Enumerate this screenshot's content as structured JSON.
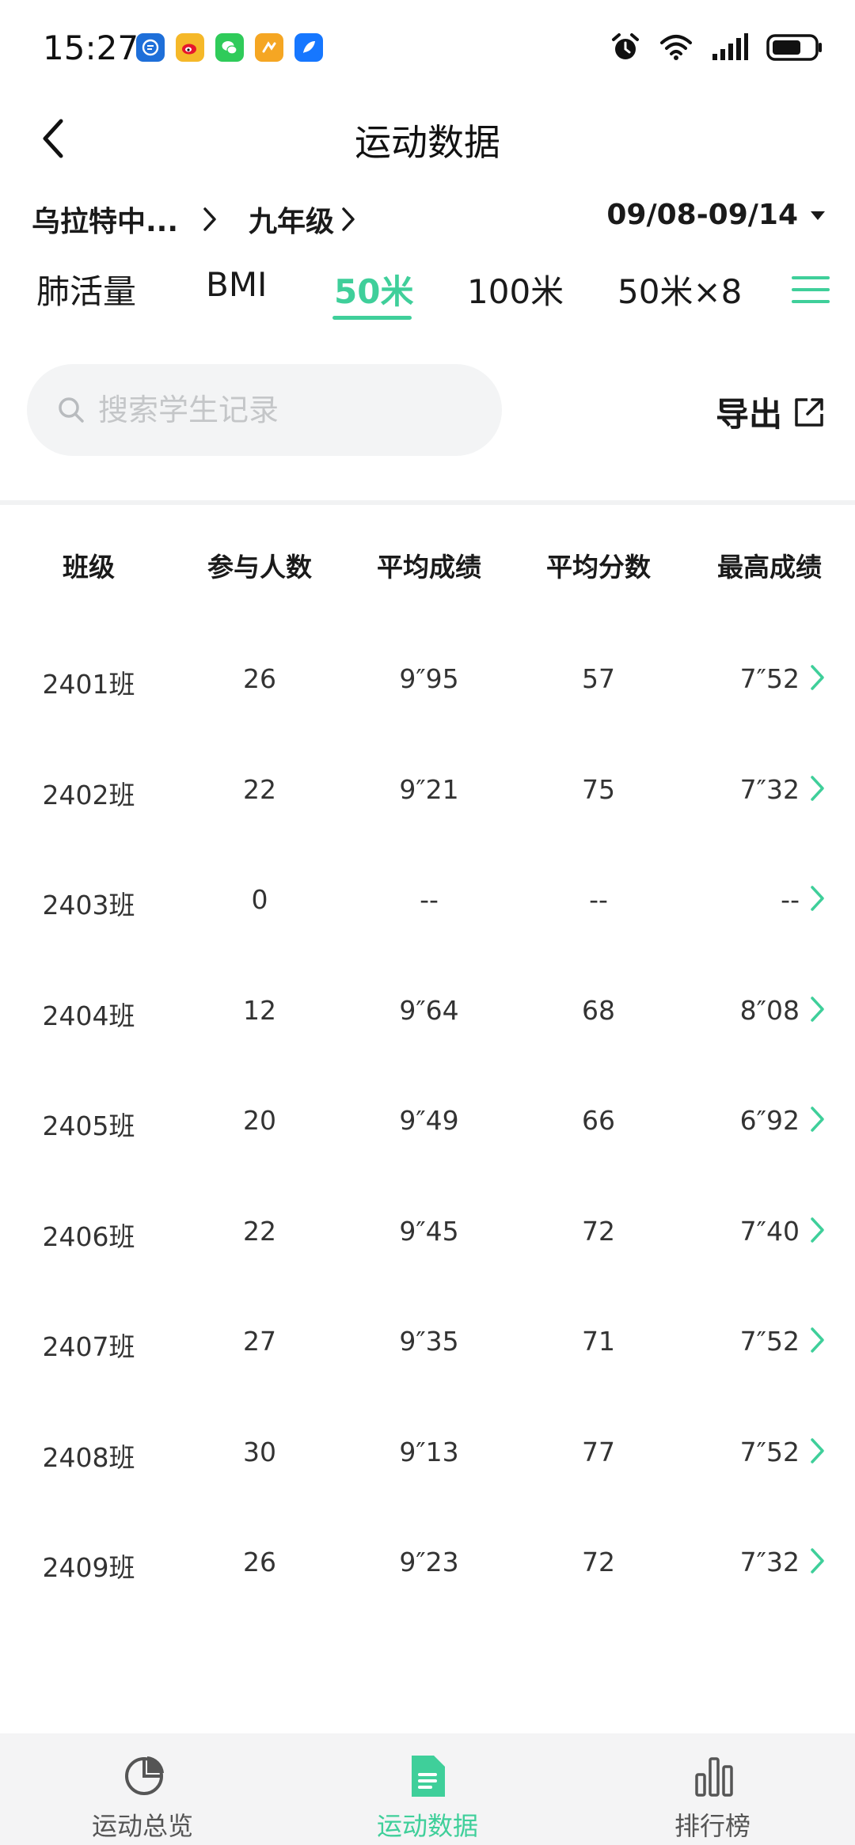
{
  "status_bar": {
    "time": "15:27",
    "app_icons": [
      {
        "name": "message-app-icon",
        "color": "#1e6fd9"
      },
      {
        "name": "weibo-icon",
        "color": "#f5b829"
      },
      {
        "name": "wechat-icon",
        "color": "#2fcb5a"
      },
      {
        "name": "sport-app-icon",
        "color": "#f5a623"
      },
      {
        "name": "feather-app-icon",
        "color": "#1677ff"
      }
    ],
    "battery_level": 0.65
  },
  "header": {
    "title": "运动数据"
  },
  "filters": {
    "school": "乌拉特中...",
    "grade": "九年级",
    "date_range": "09/08-09/14"
  },
  "tabs": [
    {
      "label": "肺活量",
      "active": false
    },
    {
      "label": "BMI",
      "active": false
    },
    {
      "label": "50米",
      "active": true
    },
    {
      "label": "100米",
      "active": false
    },
    {
      "label": "50米×8",
      "active": false
    }
  ],
  "search": {
    "placeholder": "搜索学生记录",
    "value": ""
  },
  "export": {
    "label": "导出"
  },
  "table": {
    "columns": [
      "班级",
      "参与人数",
      "平均成绩",
      "平均分数",
      "最高成绩"
    ],
    "rows": [
      [
        "2401班",
        "26",
        "9″95",
        "57",
        "7″52"
      ],
      [
        "2402班",
        "22",
        "9″21",
        "75",
        "7″32"
      ],
      [
        "2403班",
        "0",
        "--",
        "--",
        "--"
      ],
      [
        "2404班",
        "12",
        "9″64",
        "68",
        "8″08"
      ],
      [
        "2405班",
        "20",
        "9″49",
        "66",
        "6″92"
      ],
      [
        "2406班",
        "22",
        "9″45",
        "72",
        "7″40"
      ],
      [
        "2407班",
        "27",
        "9″35",
        "71",
        "7″52"
      ],
      [
        "2408班",
        "30",
        "9″13",
        "77",
        "7″52"
      ],
      [
        "2409班",
        "26",
        "9″23",
        "72",
        "7″32"
      ]
    ]
  },
  "bottom_nav": [
    {
      "label": "运动总览",
      "icon": "pie-chart-icon",
      "active": false
    },
    {
      "label": "运动数据",
      "icon": "document-icon",
      "active": true
    },
    {
      "label": "排行榜",
      "icon": "bar-chart-icon",
      "active": false
    }
  ],
  "colors": {
    "accent": "#3fcf9a",
    "text": "#1a1a1a",
    "muted": "#c4c6c8",
    "nav_bg": "#f4f4f5"
  }
}
